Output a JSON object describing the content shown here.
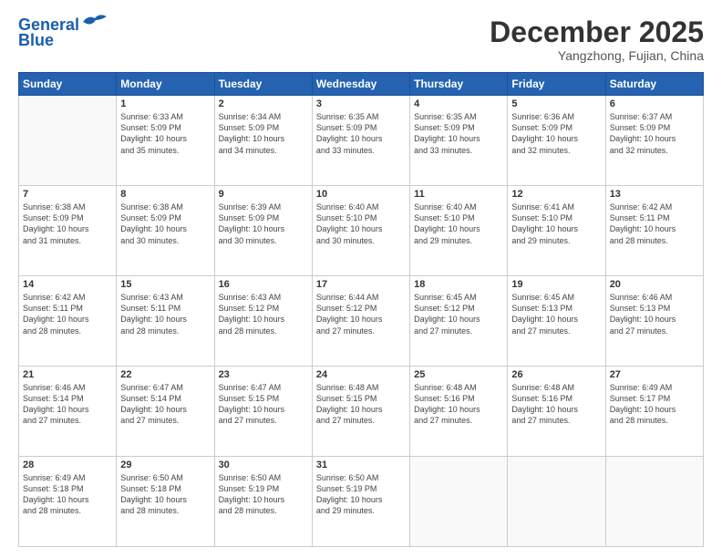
{
  "header": {
    "logo_line1": "General",
    "logo_line2": "Blue",
    "month": "December 2025",
    "location": "Yangzhong, Fujian, China"
  },
  "weekdays": [
    "Sunday",
    "Monday",
    "Tuesday",
    "Wednesday",
    "Thursday",
    "Friday",
    "Saturday"
  ],
  "weeks": [
    [
      {
        "day": "",
        "info": ""
      },
      {
        "day": "1",
        "info": "Sunrise: 6:33 AM\nSunset: 5:09 PM\nDaylight: 10 hours\nand 35 minutes."
      },
      {
        "day": "2",
        "info": "Sunrise: 6:34 AM\nSunset: 5:09 PM\nDaylight: 10 hours\nand 34 minutes."
      },
      {
        "day": "3",
        "info": "Sunrise: 6:35 AM\nSunset: 5:09 PM\nDaylight: 10 hours\nand 33 minutes."
      },
      {
        "day": "4",
        "info": "Sunrise: 6:35 AM\nSunset: 5:09 PM\nDaylight: 10 hours\nand 33 minutes."
      },
      {
        "day": "5",
        "info": "Sunrise: 6:36 AM\nSunset: 5:09 PM\nDaylight: 10 hours\nand 32 minutes."
      },
      {
        "day": "6",
        "info": "Sunrise: 6:37 AM\nSunset: 5:09 PM\nDaylight: 10 hours\nand 32 minutes."
      }
    ],
    [
      {
        "day": "7",
        "info": "Sunrise: 6:38 AM\nSunset: 5:09 PM\nDaylight: 10 hours\nand 31 minutes."
      },
      {
        "day": "8",
        "info": "Sunrise: 6:38 AM\nSunset: 5:09 PM\nDaylight: 10 hours\nand 30 minutes."
      },
      {
        "day": "9",
        "info": "Sunrise: 6:39 AM\nSunset: 5:09 PM\nDaylight: 10 hours\nand 30 minutes."
      },
      {
        "day": "10",
        "info": "Sunrise: 6:40 AM\nSunset: 5:10 PM\nDaylight: 10 hours\nand 30 minutes."
      },
      {
        "day": "11",
        "info": "Sunrise: 6:40 AM\nSunset: 5:10 PM\nDaylight: 10 hours\nand 29 minutes."
      },
      {
        "day": "12",
        "info": "Sunrise: 6:41 AM\nSunset: 5:10 PM\nDaylight: 10 hours\nand 29 minutes."
      },
      {
        "day": "13",
        "info": "Sunrise: 6:42 AM\nSunset: 5:11 PM\nDaylight: 10 hours\nand 28 minutes."
      }
    ],
    [
      {
        "day": "14",
        "info": "Sunrise: 6:42 AM\nSunset: 5:11 PM\nDaylight: 10 hours\nand 28 minutes."
      },
      {
        "day": "15",
        "info": "Sunrise: 6:43 AM\nSunset: 5:11 PM\nDaylight: 10 hours\nand 28 minutes."
      },
      {
        "day": "16",
        "info": "Sunrise: 6:43 AM\nSunset: 5:12 PM\nDaylight: 10 hours\nand 28 minutes."
      },
      {
        "day": "17",
        "info": "Sunrise: 6:44 AM\nSunset: 5:12 PM\nDaylight: 10 hours\nand 27 minutes."
      },
      {
        "day": "18",
        "info": "Sunrise: 6:45 AM\nSunset: 5:12 PM\nDaylight: 10 hours\nand 27 minutes."
      },
      {
        "day": "19",
        "info": "Sunrise: 6:45 AM\nSunset: 5:13 PM\nDaylight: 10 hours\nand 27 minutes."
      },
      {
        "day": "20",
        "info": "Sunrise: 6:46 AM\nSunset: 5:13 PM\nDaylight: 10 hours\nand 27 minutes."
      }
    ],
    [
      {
        "day": "21",
        "info": "Sunrise: 6:46 AM\nSunset: 5:14 PM\nDaylight: 10 hours\nand 27 minutes."
      },
      {
        "day": "22",
        "info": "Sunrise: 6:47 AM\nSunset: 5:14 PM\nDaylight: 10 hours\nand 27 minutes."
      },
      {
        "day": "23",
        "info": "Sunrise: 6:47 AM\nSunset: 5:15 PM\nDaylight: 10 hours\nand 27 minutes."
      },
      {
        "day": "24",
        "info": "Sunrise: 6:48 AM\nSunset: 5:15 PM\nDaylight: 10 hours\nand 27 minutes."
      },
      {
        "day": "25",
        "info": "Sunrise: 6:48 AM\nSunset: 5:16 PM\nDaylight: 10 hours\nand 27 minutes."
      },
      {
        "day": "26",
        "info": "Sunrise: 6:48 AM\nSunset: 5:16 PM\nDaylight: 10 hours\nand 27 minutes."
      },
      {
        "day": "27",
        "info": "Sunrise: 6:49 AM\nSunset: 5:17 PM\nDaylight: 10 hours\nand 28 minutes."
      }
    ],
    [
      {
        "day": "28",
        "info": "Sunrise: 6:49 AM\nSunset: 5:18 PM\nDaylight: 10 hours\nand 28 minutes."
      },
      {
        "day": "29",
        "info": "Sunrise: 6:50 AM\nSunset: 5:18 PM\nDaylight: 10 hours\nand 28 minutes."
      },
      {
        "day": "30",
        "info": "Sunrise: 6:50 AM\nSunset: 5:19 PM\nDaylight: 10 hours\nand 28 minutes."
      },
      {
        "day": "31",
        "info": "Sunrise: 6:50 AM\nSunset: 5:19 PM\nDaylight: 10 hours\nand 29 minutes."
      },
      {
        "day": "",
        "info": ""
      },
      {
        "day": "",
        "info": ""
      },
      {
        "day": "",
        "info": ""
      }
    ]
  ]
}
